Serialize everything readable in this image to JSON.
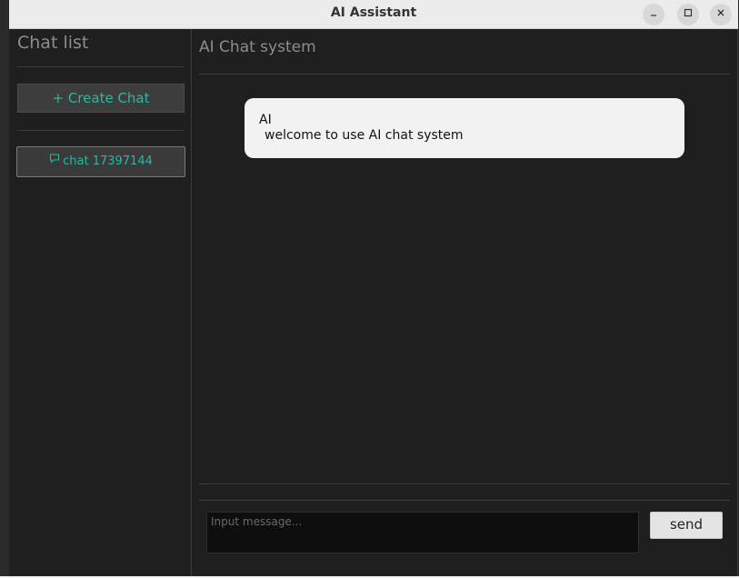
{
  "window": {
    "title": "AI Assistant"
  },
  "sidebar": {
    "title": "Chat list",
    "create_label": "+ Create Chat",
    "items": [
      {
        "label": "chat 17397144",
        "icon": "message-bubble-icon"
      }
    ]
  },
  "main": {
    "title": "AI Chat system",
    "messages": [
      {
        "sender": "AI",
        "text": "welcome to use AI chat system"
      }
    ],
    "input": {
      "placeholder": "Input message...",
      "value": ""
    },
    "send_label": "send"
  },
  "colors": {
    "accent": "#29b8a3",
    "background": "#1f1f1f",
    "bubble": "#f2f2f2"
  },
  "icons": {
    "minimize": "minimize-icon",
    "maximize": "maximize-icon",
    "close": "close-icon"
  }
}
